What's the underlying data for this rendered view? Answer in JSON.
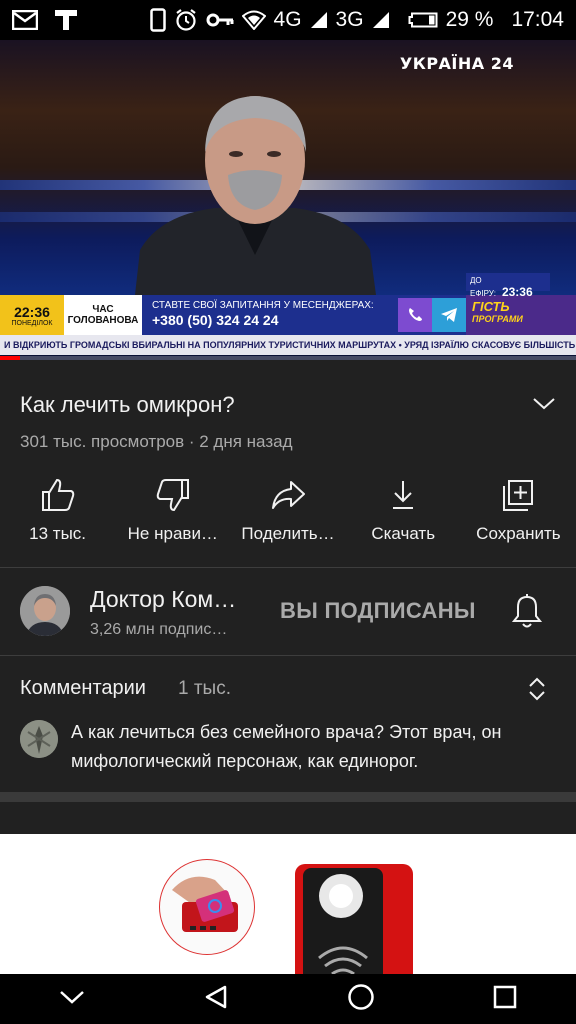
{
  "status_bar": {
    "signal_4g": "4G",
    "signal_3g": "3G",
    "battery": "29 %",
    "time": "17:04",
    "icons": [
      "mail-icon",
      "t-icon",
      "phone-icon",
      "alarm-icon",
      "key-icon",
      "hotspot-icon",
      "battery-icon"
    ]
  },
  "video": {
    "channel_logo": "УКРАЇНА 24",
    "broadcast_time": "22:36",
    "broadcast_day": "ПОНЕДІЛОК",
    "show_name_line1": "ЧАС",
    "show_name_line2": "ГОЛОВАНОВА",
    "message_line": "СТАВТЕ СВОЇ ЗАПИТАННЯ У МЕСЕНДЖЕРАХ:",
    "phone": "+380 (50) 324 24 24",
    "on_air_label": "ДО ЕФІРУ:",
    "on_air_time": "23:36",
    "promo_line1": "ГІСТЬ",
    "promo_line2": "ПРОГРАМИ",
    "ticker": "И ВІДКРИЮТЬ ГРОМАДСЬКІ ВБИРАЛЬНІ НА ПОПУЛЯРНИХ ТУРИСТИЧНИХ МАРШРУТАХ  •  УРЯД ІЗРАЇЛЮ СКАСОВУЄ БІЛЬШІСТЬ КАРАНТИННИХ",
    "progress": 0.035
  },
  "details": {
    "title": "Как лечить омикрон?",
    "meta": "301 тыс. просмотров · 2 дня назад"
  },
  "actions": [
    {
      "icon": "like-icon",
      "label": "13 тыс."
    },
    {
      "icon": "dislike-icon",
      "label": "Не нрави…"
    },
    {
      "icon": "share-icon",
      "label": "Поделить…"
    },
    {
      "icon": "download-icon",
      "label": "Скачать"
    },
    {
      "icon": "save-icon",
      "label": "Сохранить"
    }
  ],
  "channel": {
    "name": "Доктор Ком…",
    "subscribers": "3,26 млн подпис…",
    "subscribe_state": "ВЫ ПОДПИСАНЫ"
  },
  "comments": {
    "header": "Комментарии",
    "count": "1 тыс.",
    "top_comment": "А как лечиться без семейного врача? Этот врач, он мифологический персонаж, как единорог."
  },
  "nav": [
    "back-chevron-icon",
    "back-triangle-icon",
    "home-circle-icon",
    "recents-square-icon"
  ],
  "colors": {
    "accent": "#ff0000",
    "background": "#212121"
  }
}
